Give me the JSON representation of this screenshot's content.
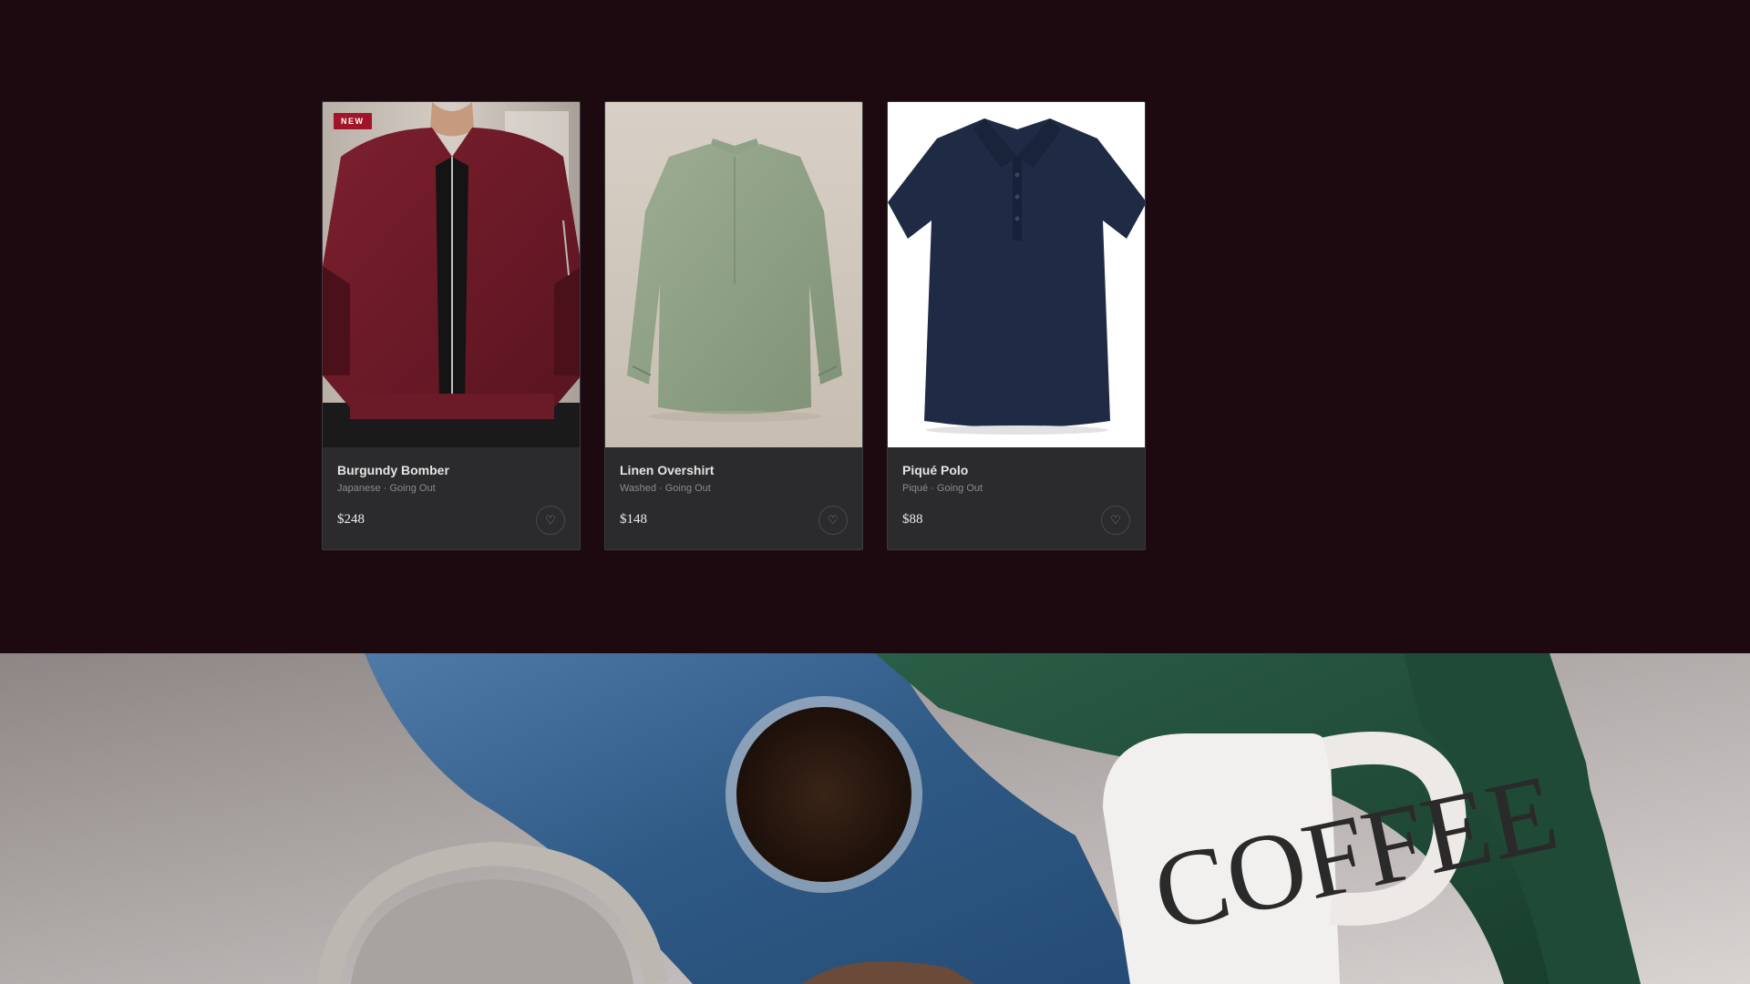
{
  "products": [
    {
      "name": "Burgundy Bomber",
      "meta": "Japanese · Going Out",
      "price": "$248",
      "badge": "NEW",
      "image": "burgundy-bomber-jacket-photo"
    },
    {
      "name": "Linen Overshirt",
      "meta": "Washed · Going Out",
      "price": "$148",
      "image": "sage-linen-overshirt-photo"
    },
    {
      "name": "Piqué Polo",
      "meta": "Piqué · Going Out",
      "price": "$88",
      "image": "navy-pique-polo-photo"
    }
  ],
  "hero": {
    "mug_text": "COFFEE",
    "image": "denim-coffee-flatlay-photo"
  },
  "icons": {
    "favorite": "heart-icon"
  },
  "colors": {
    "page_bg": "#1c0a10",
    "card_bg": "#2b2b2d",
    "badge_bg": "#a2142a"
  }
}
